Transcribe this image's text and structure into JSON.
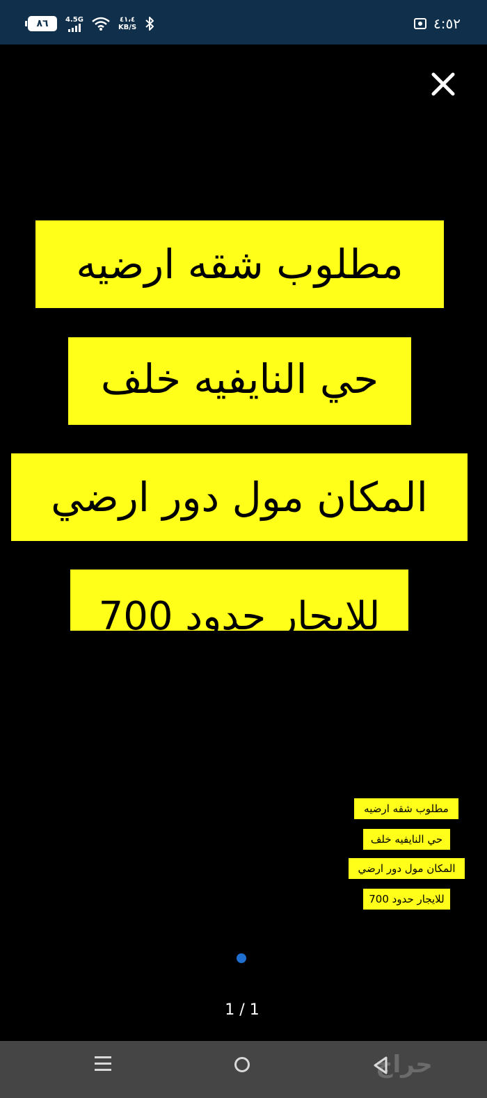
{
  "status_bar": {
    "battery_level": "٨٦",
    "network_type": "4.5G",
    "speed_value": "٤١،٤",
    "speed_unit": "KB/S",
    "time": "٤:٥٢",
    "icons": [
      "battery-icon",
      "signal-icon",
      "wifi-icon",
      "bluetooth-icon",
      "vpn-icon"
    ]
  },
  "viewer": {
    "close_icon": "close-icon",
    "banners": [
      "مطلوب شقه ارضيه",
      "حي النايفيه خلف",
      "المكان مول دور ارضي",
      "للايجار حدود 700"
    ],
    "caption_lines": [
      "مطلوب شقه ارضيه",
      "حي النايفيه خلف",
      "المكان مول دور ارضي",
      "للايجار حدود 700"
    ],
    "page_counter": "1 / 1",
    "colors": {
      "banner_background": "#ffff1a",
      "page_dot": "#1e6fd0"
    }
  },
  "nav_bar": {
    "icons": [
      "menu-icon",
      "home-icon",
      "back-icon"
    ],
    "watermark": "حراج"
  }
}
